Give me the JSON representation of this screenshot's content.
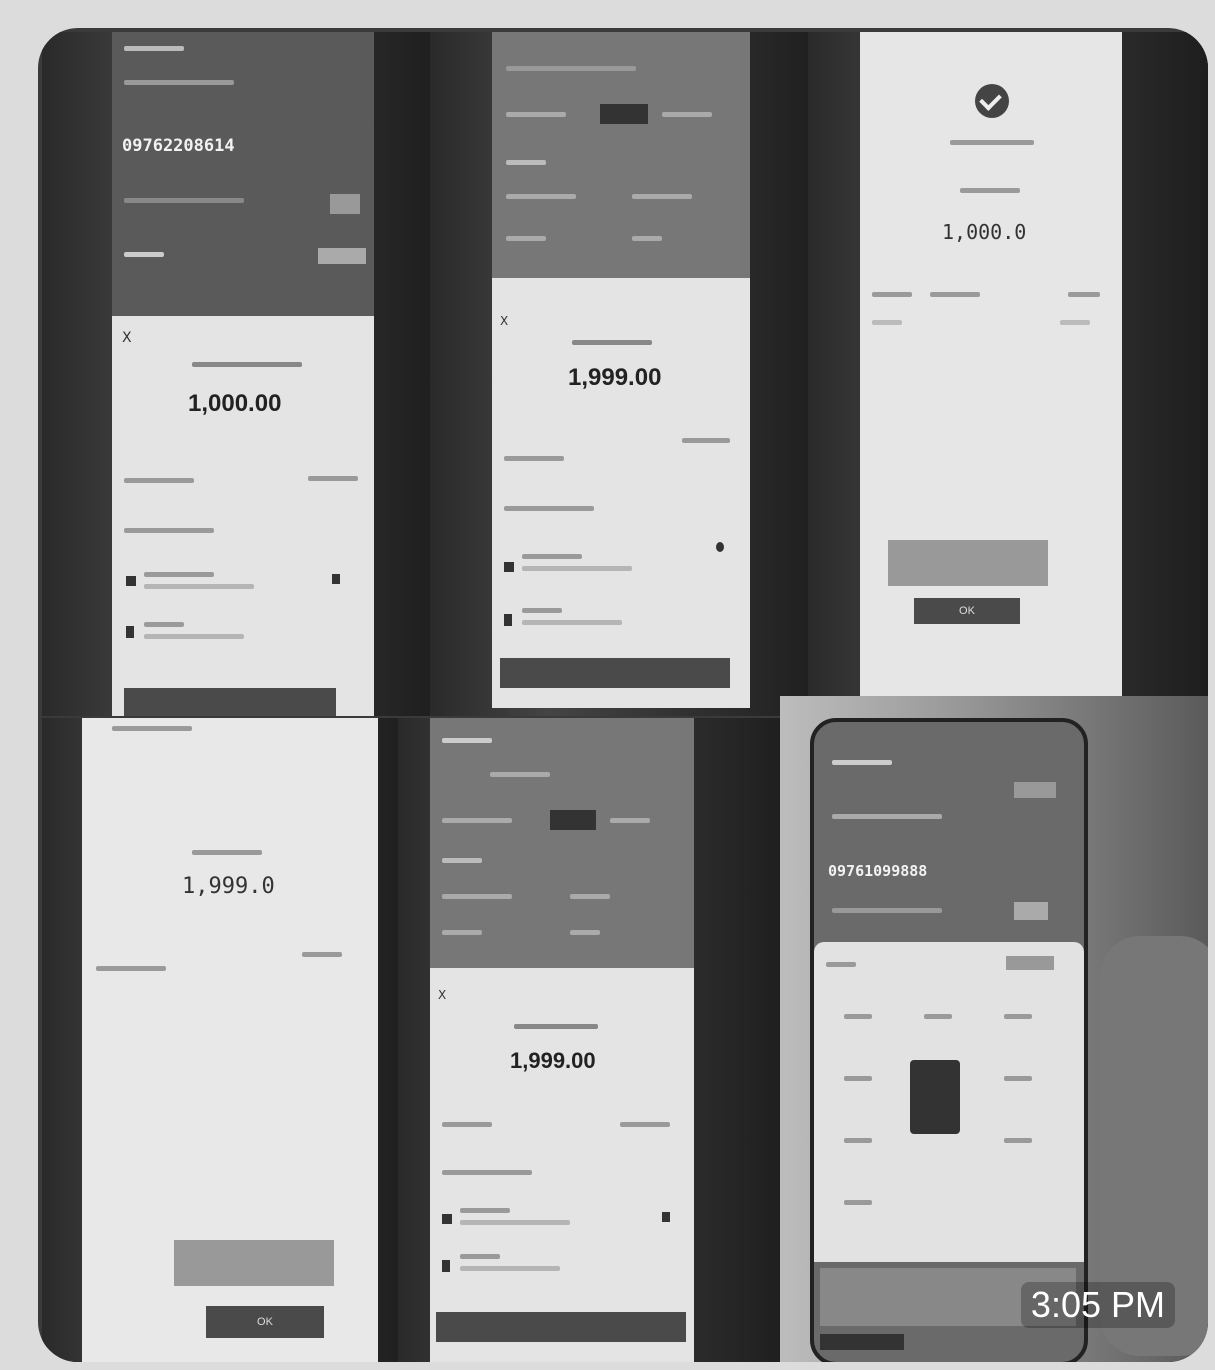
{
  "screens": {
    "s1": {
      "phone_number": "09762208614",
      "amount": "1,000.00",
      "close_label": "X"
    },
    "s2": {
      "amount": "1,999.00",
      "close_label": "X"
    },
    "s3": {
      "amount": "1,000.0",
      "ok_label": "OK"
    },
    "s4": {
      "amount": "1,999.0",
      "ok_label": "OK"
    },
    "s5": {
      "amount": "1,999.00",
      "close_label": "X"
    },
    "s6": {
      "phone_number": "09761099888"
    }
  },
  "timestamp": "3:05 PM",
  "colors": {
    "page": "#dcdcdc",
    "frame": "#3a3a3a",
    "screen": "#d8d8d8"
  }
}
